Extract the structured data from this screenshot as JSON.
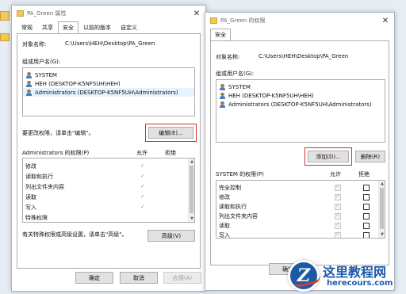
{
  "window1": {
    "title": "PA_Green 属性",
    "close_glyph": "✕",
    "tabs": [
      "常规",
      "共享",
      "安全",
      "以前的版本",
      "自定义"
    ],
    "object_label": "对象名称:",
    "object_path": "C:\\Users\\HEH\\Desktop\\PA_Green",
    "groups_label": "组或用户名(G):",
    "users": [
      "SYSTEM",
      "HEH (DESKTOP-K5NF5UH\\HEH)",
      "Administrators (DESKTOP-K5NF5UH\\Administrators)"
    ],
    "edit_hint": "要更改权限，请单击\"编辑\"。",
    "edit_button": "编辑(E)...",
    "perm_header": "Administrators 的权限(P)",
    "allow_header": "允许",
    "deny_header": "拒绝",
    "permissions": [
      "修改",
      "读取和执行",
      "列出文件夹内容",
      "读取",
      "写入",
      "特殊权限"
    ],
    "check_glyph": "✓",
    "special_hint": "有关特殊权限或高级设置，请单击\"高级\"。",
    "advanced_button": "高级(V)",
    "ok_button": "确定",
    "cancel_button": "取消",
    "apply_button": "应用(A)"
  },
  "window2": {
    "title": "PA_Green 的权限",
    "close_glyph": "✕",
    "tab": "安全",
    "object_label": "对象名称:",
    "object_path": "C:\\Users\\HEH\\Desktop\\PA_Green",
    "groups_label": "组或用户名(G):",
    "users": [
      "SYSTEM",
      "HEH (DESKTOP-K5NF5UH\\HEH)",
      "Administrators (DESKTOP-K5NF5UH\\Administrators)"
    ],
    "add_button": "添加(D)...",
    "remove_button": "删除(R)",
    "perm_header": "SYSTEM 的权限(P)",
    "allow_header": "允许",
    "deny_header": "拒绝",
    "permissions": [
      "完全控制",
      "修改",
      "读取和执行",
      "列出文件夹内容",
      "读取",
      "写入"
    ],
    "ok_button": "确定"
  },
  "watermark": {
    "title": "这里教程网",
    "domain": "herecours.com",
    "logo_letter": "Z"
  },
  "colors": {
    "highlight": "#d0312d",
    "brand": "#1d5aa6"
  }
}
